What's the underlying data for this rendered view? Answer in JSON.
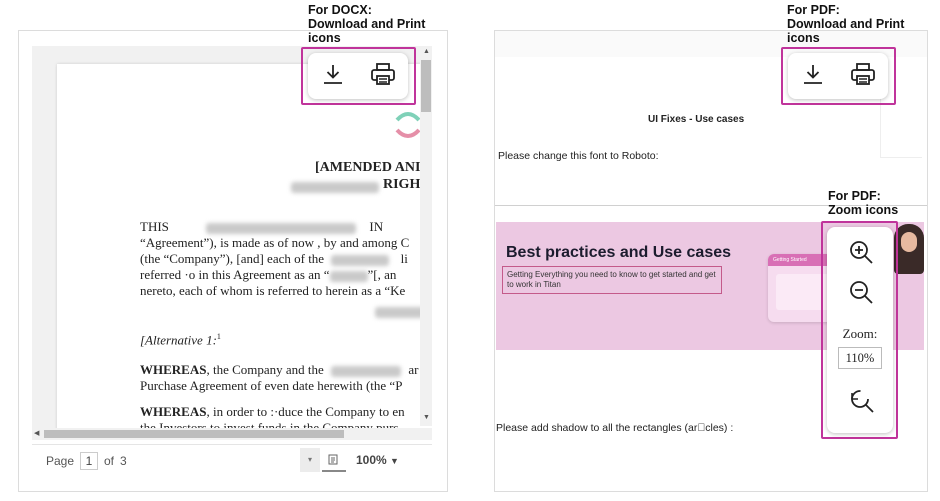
{
  "callouts": {
    "docx": "For DOCX:\nDownload and Print\nicons",
    "pdf_top": "For PDF:\nDownload and Print\nicons",
    "pdf_zoom": "For PDF:\nZoom icons"
  },
  "docx_viewer": {
    "doc_title_line1": "[AMENDED ANI",
    "doc_title_line2": "RIGHT",
    "para1_start": "THIS",
    "para1_end": "IN",
    "line2": "“Agreement”), is made as of now , by and among C",
    "line3a": "(the “Company”), [and] each of the",
    "line3b": "li",
    "line4a": "referred ·o in this Agreement as an “",
    "line4b": "”[, an",
    "line5": "nereto, each of whom is referred to herein as a “Ke",
    "alternative": "[Alternative 1:",
    "footnote": "1",
    "whereas1_bold": "WHEREAS",
    "whereas1_rest": ", the Company and the",
    "whereas1_end": "ar",
    "whereas1_line2": "Purchase Agreement of even date herewith (the “P",
    "whereas2_bold": "WHEREAS",
    "whereas2_rest": ", in order to :·duce the Company to en",
    "whereas2_line2": "the Investors to invest funds in the Company purs",
    "page_label": "Page",
    "page_current": "1",
    "page_of": "of",
    "page_total": "3",
    "zoom_value": "100%"
  },
  "pdf_viewer": {
    "doc_heading": "UI Fixes - Use cases",
    "instruction1": "Please change this font to Roboto:",
    "banner_title": "Best practices and Use cases",
    "banner_subtitle": "Getting Everything you need to know to get started and get to work in Titan",
    "banner_card_tag": "Getting Started",
    "instruction2": "Please add shadow to all the rectangles (ar\u0000cles) :",
    "zoom_label": "Zoom:",
    "zoom_value": "110%"
  },
  "colors": {
    "highlight": "#c0349b",
    "banner": "#ecc8e2"
  }
}
